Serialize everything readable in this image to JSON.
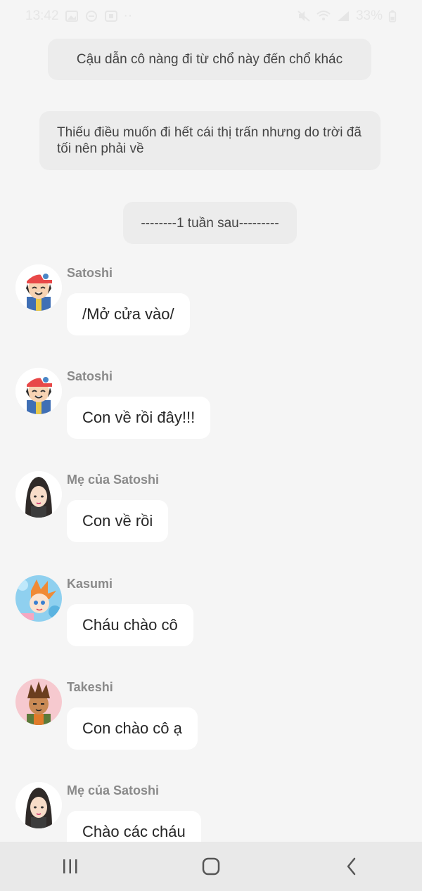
{
  "status_bar": {
    "time": "13:42",
    "battery": "33%",
    "icons_left": [
      "gallery-icon",
      "face-icon",
      "dl-icon",
      "more-icon"
    ],
    "icons_right": [
      "mute-icon",
      "wifi-icon",
      "signal-icon",
      "battery-icon"
    ]
  },
  "narrations": [
    {
      "text": "Cậu dẫn cô nàng đi từ chổ này đến chổ khác"
    },
    {
      "text": "Thiếu điều muốn đi hết cái thị trấn nhưng do trời đã tối nên phải về"
    },
    {
      "text": "--------1 tuần sau---------"
    }
  ],
  "messages": [
    {
      "sender": "Satoshi",
      "text": "/Mở cửa vào/",
      "avatar": "satoshi-avatar"
    },
    {
      "sender": "Satoshi",
      "text": "Con về rồi đây!!!",
      "avatar": "satoshi-avatar"
    },
    {
      "sender": "Mẹ của Satoshi",
      "text": "Con về rồi",
      "avatar": "mother-avatar"
    },
    {
      "sender": "Kasumi",
      "text": "Cháu chào cô",
      "avatar": "kasumi-avatar"
    },
    {
      "sender": "Takeshi",
      "text": "Con chào cô ạ",
      "avatar": "takeshi-avatar"
    },
    {
      "sender": "Mẹ của Satoshi",
      "text": "Chào các cháu",
      "avatar": "mother-avatar"
    }
  ],
  "nav_bar": {
    "buttons": [
      "recent-apps-icon",
      "home-icon",
      "back-icon"
    ]
  },
  "colors": {
    "background": "#f5f5f5",
    "narration_bg": "#ececec",
    "bubble_bg": "#ffffff",
    "sender": "#8a8a8a",
    "nav_bg": "#e9e9e9"
  }
}
